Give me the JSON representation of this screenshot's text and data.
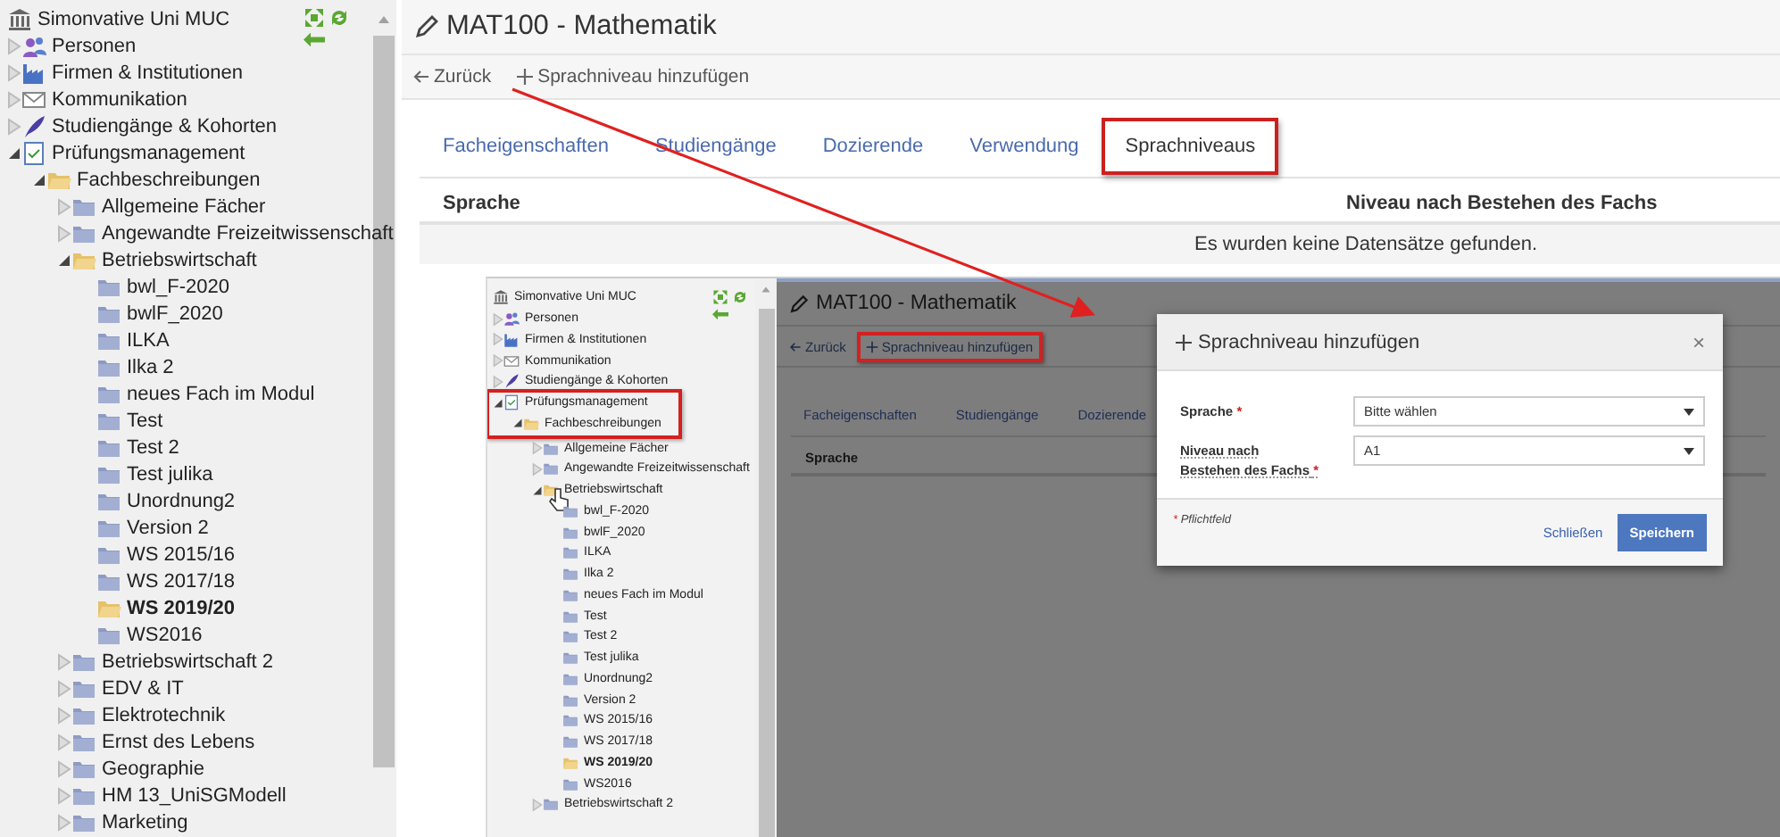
{
  "sidebar": {
    "root": {
      "label": "Simonvative Uni MUC"
    },
    "tree": [
      {
        "label": "Personen",
        "kind": "persons",
        "expanded": false,
        "selected": false
      },
      {
        "label": "Firmen & Institutionen",
        "kind": "factory",
        "expanded": false,
        "selected": false
      },
      {
        "label": "Kommunikation",
        "kind": "mail",
        "expanded": false,
        "selected": false
      },
      {
        "label": "Studiengänge & Kohorten",
        "kind": "feather",
        "expanded": false,
        "selected": false
      },
      {
        "label": "Prüfungsmanagement",
        "kind": "checklist",
        "expanded": true,
        "selected": false,
        "children": [
          {
            "label": "Fachbeschreibungen",
            "kind": "folder",
            "expanded": true,
            "selected": false,
            "children": [
              {
                "label": "Allgemeine Fächer",
                "kind": "folder",
                "expanded": false,
                "selected": false
              },
              {
                "label": "Angewandte Freizeitwissenschaft",
                "kind": "folder",
                "expanded": false,
                "selected": false
              },
              {
                "label": "Betriebswirtschaft",
                "kind": "folder",
                "expanded": true,
                "selected": false,
                "children": [
                  {
                    "label": "bwl_F-2020",
                    "kind": "folder",
                    "selected": false
                  },
                  {
                    "label": "bwlF_2020",
                    "kind": "folder",
                    "selected": false
                  },
                  {
                    "label": "ILKA",
                    "kind": "folder",
                    "selected": false
                  },
                  {
                    "label": "Ilka 2",
                    "kind": "folder",
                    "selected": false
                  },
                  {
                    "label": "neues Fach im Modul",
                    "kind": "folder",
                    "selected": false
                  },
                  {
                    "label": "Test",
                    "kind": "folder",
                    "selected": false
                  },
                  {
                    "label": "Test 2",
                    "kind": "folder",
                    "selected": false
                  },
                  {
                    "label": "Test julika",
                    "kind": "folder",
                    "selected": false
                  },
                  {
                    "label": "Unordnung2",
                    "kind": "folder",
                    "selected": false
                  },
                  {
                    "label": "Version 2",
                    "kind": "folder",
                    "selected": false
                  },
                  {
                    "label": "WS 2015/16",
                    "kind": "folder",
                    "selected": false
                  },
                  {
                    "label": "WS 2017/18",
                    "kind": "folder",
                    "selected": false
                  },
                  {
                    "label": "WS 2019/20",
                    "kind": "folder",
                    "selected": true
                  },
                  {
                    "label": "WS2016",
                    "kind": "folder",
                    "selected": false
                  }
                ]
              },
              {
                "label": "Betriebswirtschaft 2",
                "kind": "folder",
                "expanded": false,
                "selected": false
              },
              {
                "label": "EDV & IT",
                "kind": "folder",
                "expanded": false,
                "selected": false
              },
              {
                "label": "Elektrotechnik",
                "kind": "folder",
                "expanded": false,
                "selected": false
              },
              {
                "label": "Ernst des Lebens",
                "kind": "folder",
                "expanded": false,
                "selected": false
              },
              {
                "label": "Geographie",
                "kind": "folder",
                "expanded": false,
                "selected": false
              },
              {
                "label": "HM 13_UniSGModell",
                "kind": "folder",
                "expanded": false,
                "selected": false
              },
              {
                "label": "Marketing",
                "kind": "folder",
                "expanded": false,
                "selected": false
              }
            ]
          }
        ]
      }
    ]
  },
  "page": {
    "title": "MAT100 - Mathematik",
    "toolbar": [
      {
        "kind": "back",
        "label": "Zurück"
      },
      {
        "kind": "add",
        "label": "Sprachniveau hinzufügen"
      }
    ],
    "tabs": [
      {
        "label": "Facheigenschaften",
        "selected": false,
        "highlighted": false
      },
      {
        "label": "Studiengänge",
        "selected": false,
        "highlighted": false
      },
      {
        "label": "Dozierende",
        "selected": false,
        "highlighted": false
      },
      {
        "label": "Verwendung",
        "selected": false,
        "highlighted": false
      },
      {
        "label": "Sprachniveaus",
        "selected": true,
        "highlighted": true
      }
    ],
    "table": {
      "columns": [
        "Sprache",
        "Niveau nach Bestehen des Fachs"
      ],
      "empty_message": "Es wurden keine Datensätze gefunden."
    }
  },
  "screenshot": {
    "sidebar": {
      "root": {
        "label": "Simonvative Uni MUC"
      },
      "tree": [
        {
          "label": "Personen",
          "kind": "persons",
          "expanded": false,
          "selected": false
        },
        {
          "label": "Firmen & Institutionen",
          "kind": "factory",
          "expanded": false,
          "selected": false
        },
        {
          "label": "Kommunikation",
          "kind": "mail",
          "expanded": false,
          "selected": false
        },
        {
          "label": "Studiengänge & Kohorten",
          "kind": "feather",
          "expanded": false,
          "selected": false
        },
        {
          "label": "Prüfungsmanagement",
          "kind": "checklist",
          "expanded": true,
          "selected": false,
          "highlighted": true,
          "children": [
            {
              "label": "Fachbeschreibungen",
              "kind": "folder",
              "expanded": true,
              "selected": false,
              "children": [
                {
                  "label": "Allgemeine Fächer",
                  "kind": "folder",
                  "expanded": false,
                  "selected": false
                },
                {
                  "label": "Angewandte Freizeitwissenschaft",
                  "kind": "folder",
                  "expanded": false,
                  "selected": false
                },
                {
                  "label": "Betriebswirtschaft",
                  "kind": "folder",
                  "expanded": true,
                  "selected": false,
                  "pointer": true,
                  "children": [
                    {
                      "label": "bwl_F-2020",
                      "kind": "folder",
                      "selected": false
                    },
                    {
                      "label": "bwlF_2020",
                      "kind": "folder",
                      "selected": false
                    },
                    {
                      "label": "ILKA",
                      "kind": "folder",
                      "selected": false
                    },
                    {
                      "label": "Ilka 2",
                      "kind": "folder",
                      "selected": false
                    },
                    {
                      "label": "neues Fach im Modul",
                      "kind": "folder",
                      "selected": false
                    },
                    {
                      "label": "Test",
                      "kind": "folder",
                      "selected": false
                    },
                    {
                      "label": "Test 2",
                      "kind": "folder",
                      "selected": false
                    },
                    {
                      "label": "Test julika",
                      "kind": "folder",
                      "selected": false
                    },
                    {
                      "label": "Unordnung2",
                      "kind": "folder",
                      "selected": false
                    },
                    {
                      "label": "Version 2",
                      "kind": "folder",
                      "selected": false
                    },
                    {
                      "label": "WS 2015/16",
                      "kind": "folder",
                      "selected": false
                    },
                    {
                      "label": "WS 2017/18",
                      "kind": "folder",
                      "selected": false
                    },
                    {
                      "label": "WS 2019/20",
                      "kind": "folder",
                      "selected": true
                    },
                    {
                      "label": "WS2016",
                      "kind": "folder",
                      "selected": false
                    }
                  ]
                },
                {
                  "label": "Betriebswirtschaft 2",
                  "kind": "folder",
                  "expanded": false,
                  "selected": false
                }
              ]
            }
          ]
        }
      ]
    },
    "page": {
      "title": "MAT100 - Mathematik",
      "toolbar": [
        {
          "kind": "back",
          "label": "Zurück",
          "highlighted": false
        },
        {
          "kind": "add",
          "label": "Sprachniveau hinzufügen",
          "highlighted": true
        }
      ],
      "tabs": [
        {
          "label": "Facheigenschaften",
          "selected": false
        },
        {
          "label": "Studiengänge",
          "selected": false
        },
        {
          "label": "Dozierende",
          "selected": false
        }
      ],
      "table": {
        "columns": [
          "Sprache"
        ]
      }
    },
    "dialog": {
      "title": "Sprachniveau hinzufügen",
      "close": "×",
      "fields": [
        {
          "label": "Sprache",
          "required_mark": "*",
          "value": "Bitte wählen"
        },
        {
          "label": "Niveau nach Bestehen des Fachs",
          "required_mark": "*",
          "value": "A1"
        }
      ],
      "footnote_mark": "*",
      "footnote": "Pflichtfeld",
      "buttons": [
        {
          "kind": "link",
          "label": "Schließen"
        },
        {
          "kind": "primary",
          "label": "Speichern"
        }
      ]
    }
  }
}
